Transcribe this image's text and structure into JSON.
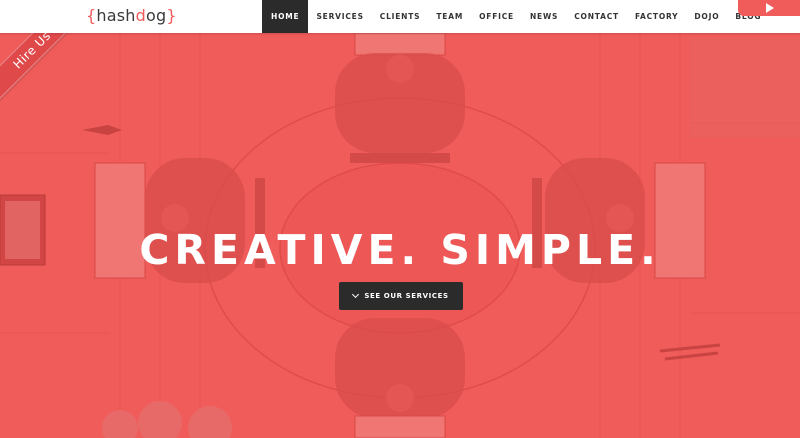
{
  "brand": {
    "logo_open": "{",
    "logo_hash": "hash",
    "logo_d": "d",
    "logo_og": "og",
    "logo_close": "}"
  },
  "nav": {
    "items": [
      {
        "label": "HOME",
        "active": true
      },
      {
        "label": "SERVICES"
      },
      {
        "label": "CLIENTS"
      },
      {
        "label": "TEAM"
      },
      {
        "label": "OFFICE"
      },
      {
        "label": "NEWS"
      },
      {
        "label": "CONTACT"
      },
      {
        "label": "FACTORY"
      },
      {
        "label": "DOJO"
      },
      {
        "label": "BLOG"
      }
    ],
    "corner_icon": "play-icon"
  },
  "ribbon": {
    "label": "Hire Us"
  },
  "hero": {
    "headline": "CREATIVE. SIMPLE.",
    "cta_label": "SEE OUR SERVICES",
    "cta_icon": "chevron-down-icon"
  },
  "colors": {
    "accent": "#ef5c5a",
    "dark": "#2b2b2b",
    "white": "#ffffff"
  }
}
